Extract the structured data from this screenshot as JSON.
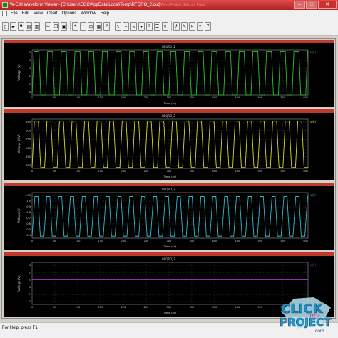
{
  "window": {
    "title": "W-Edit Waveform Viewer - [C:\\Users\\EGC\\AppData\\Local\\Temp\\RFQRO_2.out]",
    "ghost_title": "Wave Praject Selector Pane",
    "minimize_glyph": "–",
    "maximize_glyph": "□",
    "close_glyph": "✕"
  },
  "menu": [
    "File",
    "Edit",
    "View",
    "Chart",
    "Options",
    "Window",
    "Help"
  ],
  "toolbar": {
    "buttons": [
      "new-file-icon",
      "open-folder-icon",
      "save-icon",
      "print-icon",
      "print-preview-icon",
      "cut-icon",
      "copy-icon",
      "paste-icon",
      "zoom-in-icon",
      "zoom-out-icon",
      "zoom-fit-icon",
      "chart-icon",
      "grid-icon",
      "cursor-icon",
      "measure-icon",
      "trace-icon",
      "marker-icon",
      "overlay-icon",
      "stack-icon",
      "expand-icon",
      "expression-icon",
      "edit-trace-icon",
      "delete-trace-icon",
      "color-icon",
      "help-icon"
    ]
  },
  "statusbar": {
    "text": "For Help, press F1"
  },
  "colors": {
    "panel_header": "#c0392b",
    "trace_1": "#2ebd2e",
    "trace_2": "#d7d72a",
    "trace_3": "#2fb9c9",
    "trace_4": "#b12fd0",
    "grid": "#3a3a3a"
  },
  "chart_data": [
    {
      "type": "line",
      "title": "RFQRO_2",
      "xlabel": "Time (ns)",
      "ylabel": "Voltage (V)",
      "legend": "v(4)",
      "x_ticks": [
        0,
        10,
        20,
        30,
        40,
        50,
        60,
        70,
        80,
        90,
        100,
        110,
        120,
        130,
        140,
        150,
        160,
        170,
        180,
        190,
        200,
        210,
        220,
        230,
        240,
        250,
        260,
        270,
        280,
        290,
        300,
        310,
        320,
        330,
        340,
        350,
        360,
        370,
        380,
        390,
        400,
        410,
        420,
        430,
        440,
        450,
        460,
        470,
        480,
        490,
        500,
        510,
        520,
        530,
        540,
        550,
        560,
        570,
        580,
        590,
        600
      ],
      "x_tick_labels": [
        "0",
        "50",
        "100",
        "150",
        "200",
        "250",
        "300",
        "350",
        "400",
        "450",
        "500",
        "550",
        "600"
      ],
      "y_tick_labels": [
        "0",
        "1",
        "2",
        "3",
        "4",
        "5"
      ],
      "xlim": [
        0,
        605
      ],
      "ylim": [
        0,
        5.2
      ],
      "waveform": {
        "period": 30.0,
        "low": 0.0,
        "high": 5.0,
        "rise": 4,
        "fall": 4
      }
    },
    {
      "type": "line",
      "title": "RFQRO_2",
      "xlabel": "Time (ns)",
      "ylabel": "Voltage (mV)",
      "legend": "v(b)",
      "x_tick_labels": [
        "0",
        "50",
        "100",
        "150",
        "200",
        "250",
        "300",
        "350",
        "400",
        "450",
        "500",
        "550",
        "600"
      ],
      "y_tick_labels": [
        "400",
        "450",
        "500",
        "550",
        "600",
        "650"
      ],
      "xlim": [
        0,
        605
      ],
      "ylim": [
        400,
        660
      ],
      "waveform": {
        "period": 27.5,
        "low": 405,
        "high": 650,
        "rise": 5,
        "fall": 5
      }
    },
    {
      "type": "line",
      "title": "RFQRO_2",
      "xlabel": "Time (ns)",
      "ylabel": "Voltage (V)",
      "legend": "v(c)",
      "x_tick_labels": [
        "0",
        "50",
        "100",
        "150",
        "200",
        "250",
        "300",
        "350",
        "400",
        "450",
        "500",
        "550",
        "600"
      ],
      "y_tick_labels": [
        "0.4",
        "0.5",
        "0.6",
        "0.7",
        "0.8",
        "0.9",
        "1.0",
        "1.05"
      ],
      "xlim": [
        0,
        605
      ],
      "ylim": [
        0.4,
        1.1
      ],
      "waveform": {
        "period": 26.0,
        "low": 0.43,
        "high": 1.04,
        "rise": 6,
        "fall": 5
      }
    },
    {
      "type": "line",
      "title": "RFQRO_2",
      "xlabel": "Time (ns)",
      "ylabel": "Voltage (V)",
      "legend": "v(d)",
      "x_tick_labels": [
        "0",
        "50",
        "100",
        "150",
        "200",
        "250",
        "300",
        "350",
        "400",
        "450",
        "500",
        "550",
        "600"
      ],
      "y_tick_labels": [
        "-2",
        "-1",
        "0",
        "1",
        "2",
        "3"
      ],
      "xlim": [
        0,
        605
      ],
      "ylim": [
        -2.5,
        3.5
      ],
      "waveform": {
        "constant": 1.1
      }
    }
  ]
}
